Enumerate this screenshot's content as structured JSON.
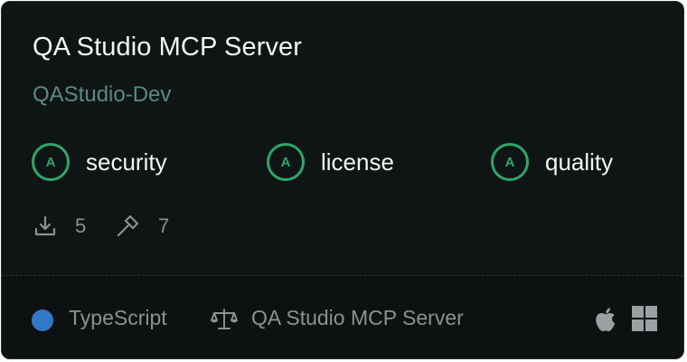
{
  "server": {
    "title": "QA Studio MCP Server",
    "author": "QAStudio-Dev"
  },
  "grades": [
    {
      "grade": "A",
      "label": "security"
    },
    {
      "grade": "A",
      "label": "license"
    },
    {
      "grade": "A",
      "label": "quality"
    }
  ],
  "stats": {
    "downloads": "5",
    "tools": "7",
    "downloads_icon": "download-icon",
    "tools_icon": "hammer-icon"
  },
  "footer": {
    "language": "TypeScript",
    "language_color": "#3178c6",
    "license_icon": "scale-icon",
    "license_name": "QA Studio MCP Server",
    "platforms": [
      "apple-icon",
      "windows-icon"
    ]
  },
  "colors": {
    "grade_accent": "#2ea66a",
    "author": "#5a8a82",
    "background": "#0f1415"
  }
}
